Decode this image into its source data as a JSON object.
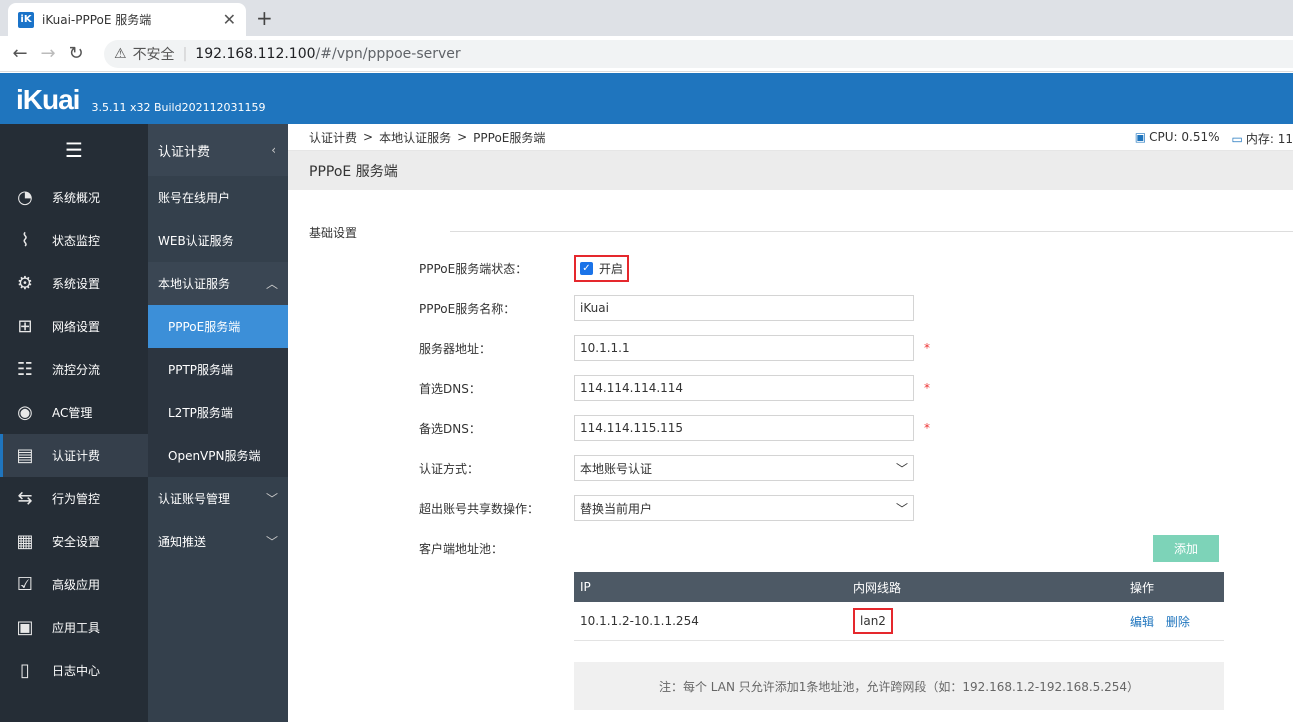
{
  "browser": {
    "tab_title": "iKuai-PPPoE 服务端",
    "favicon_text": "iK",
    "insecure_label": "不安全",
    "url_host": "192.168.112.100",
    "url_path": "/#/vpn/pppoe-server"
  },
  "app": {
    "logo": "iKuai",
    "version": "3.5.11 x32 Build202112031159"
  },
  "sidebar": {
    "items": [
      {
        "label": "系统概况",
        "icon": "dashboard-icon"
      },
      {
        "label": "状态监控",
        "icon": "monitor-icon"
      },
      {
        "label": "系统设置",
        "icon": "gear-icon"
      },
      {
        "label": "网络设置",
        "icon": "network-icon"
      },
      {
        "label": "流控分流",
        "icon": "sliders-icon"
      },
      {
        "label": "AC管理",
        "icon": "wifi-icon"
      },
      {
        "label": "认证计费",
        "icon": "id-card-icon"
      },
      {
        "label": "行为管控",
        "icon": "arrows-icon"
      },
      {
        "label": "安全设置",
        "icon": "firewall-icon"
      },
      {
        "label": "高级应用",
        "icon": "check-box-icon"
      },
      {
        "label": "应用工具",
        "icon": "apps-icon"
      },
      {
        "label": "日志中心",
        "icon": "log-icon"
      }
    ]
  },
  "subnav": {
    "header": "认证计费",
    "items": [
      {
        "label": "账号在线用户"
      },
      {
        "label": "WEB认证服务"
      },
      {
        "label": "本地认证服务"
      },
      {
        "label": "PPPoE服务端"
      },
      {
        "label": "PPTP服务端"
      },
      {
        "label": "L2TP服务端"
      },
      {
        "label": "OpenVPN服务端"
      },
      {
        "label": "认证账号管理"
      },
      {
        "label": "通知推送"
      }
    ]
  },
  "breadcrumb": {
    "b1": "认证计费",
    "b2": "本地认证服务",
    "b3": "PPPoE服务端",
    "sep": ">"
  },
  "stats": {
    "cpu": "CPU: 0.51%",
    "mem": "内存: 11"
  },
  "page": {
    "title": "PPPoE 服务端",
    "section": "基础设置"
  },
  "form": {
    "status_label": "PPPoE服务端状态：",
    "status_checkbox": "开启",
    "name_label": "PPPoE服务名称：",
    "name_value": "iKuai",
    "server_label": "服务器地址：",
    "server_value": "10.1.1.1",
    "dns1_label": "首选DNS：",
    "dns1_value": "114.114.114.114",
    "dns2_label": "备选DNS：",
    "dns2_value": "114.114.115.115",
    "auth_label": "认证方式：",
    "auth_value": "本地账号认证",
    "share_label": "超出账号共享数操作：",
    "share_value": "替换当前用户",
    "pool_label": "客户端地址池：",
    "required_mark": "*",
    "add_button": "添加"
  },
  "table": {
    "headers": [
      "IP",
      "内网线路",
      "操作"
    ],
    "rows": [
      {
        "ip": "10.1.1.2-10.1.1.254",
        "line": "lan2",
        "edit": "编辑",
        "del": "删除"
      }
    ]
  },
  "note": "注：每个 LAN 只允许添加1条地址池，允许跨网段（如：192.168.1.2-192.168.5.254）",
  "colors": {
    "accent": "#1f75be",
    "highlight": "#e5282d",
    "add_button": "#7dd3b8"
  }
}
